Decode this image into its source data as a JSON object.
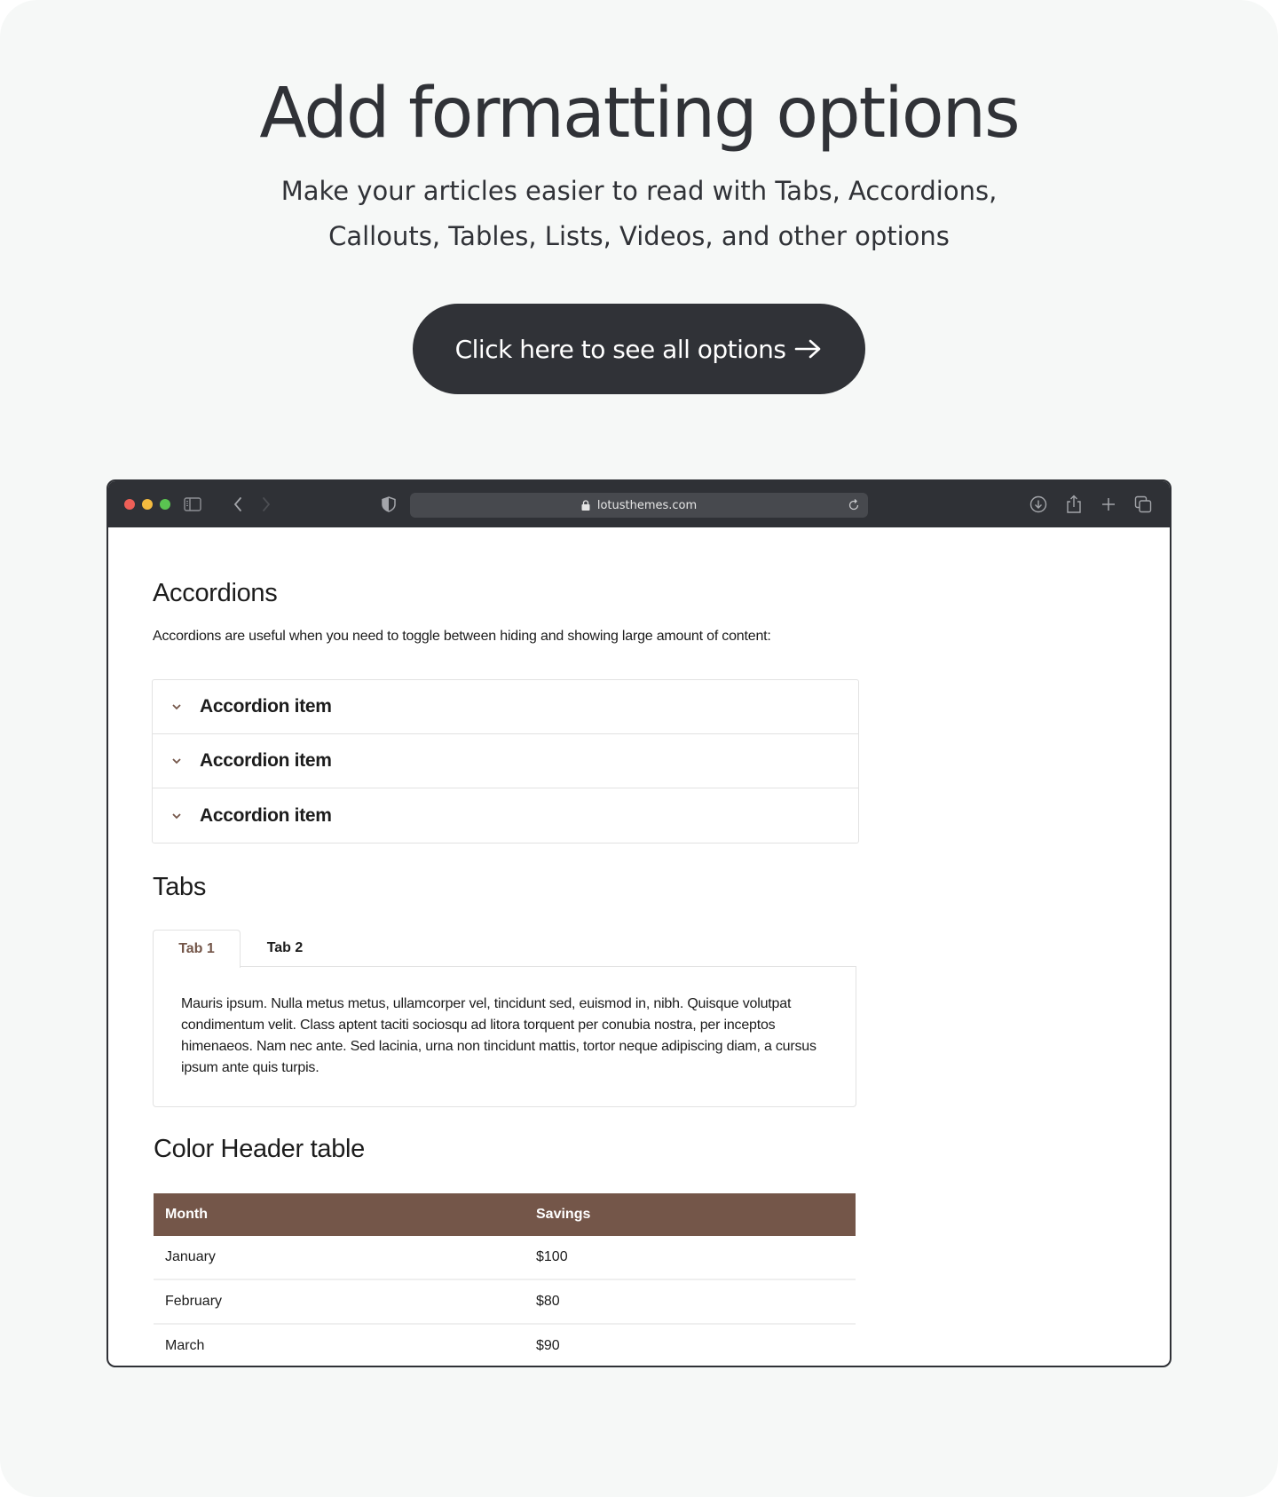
{
  "hero": {
    "title": "Add formatting options",
    "subtitle_lines": [
      "Make your articles easier to read with Tabs, Accordions,",
      "Callouts, Tables, Lists, Videos, and other options"
    ],
    "cta_label": "Click here to see all options"
  },
  "browser": {
    "url": "lotusthemes.com",
    "toolbar_icons": [
      "sidebar-icon",
      "back-icon",
      "forward-icon",
      "shield-icon",
      "lock-icon",
      "reload-icon",
      "download-icon",
      "share-icon",
      "new-tab-icon",
      "tabs-overview-icon"
    ]
  },
  "content": {
    "accordions": {
      "heading": "Accordions",
      "description": "Accordions are useful when you need to toggle between hiding and showing large amount of content:",
      "items": [
        {
          "label": "Accordion item"
        },
        {
          "label": "Accordion item"
        },
        {
          "label": "Accordion item"
        }
      ]
    },
    "tabs": {
      "heading": "Tabs",
      "items": [
        {
          "label": "Tab 1",
          "active": true
        },
        {
          "label": "Tab 2",
          "active": false
        }
      ],
      "panel_text": "Mauris ipsum. Nulla metus metus, ullamcorper vel, tincidunt sed, euismod in, nibh. Quisque volutpat condimentum velit. Class aptent taciti sociosqu ad litora torquent per conubia nostra, per inceptos himenaeos. Nam nec ante. Sed lacinia, urna non tincidunt mattis, tortor neque adipiscing diam, a cursus ipsum ante quis turpis."
    },
    "table": {
      "heading": "Color Header table",
      "header_color": "#745649",
      "columns": [
        "Month",
        "Savings"
      ],
      "rows": [
        [
          "January",
          "$100"
        ],
        [
          "February",
          "$80"
        ],
        [
          "March",
          "$90"
        ]
      ]
    }
  },
  "colors": {
    "page_bg": "#f6f8f7",
    "dark": "#303237",
    "accent": "#745649"
  }
}
